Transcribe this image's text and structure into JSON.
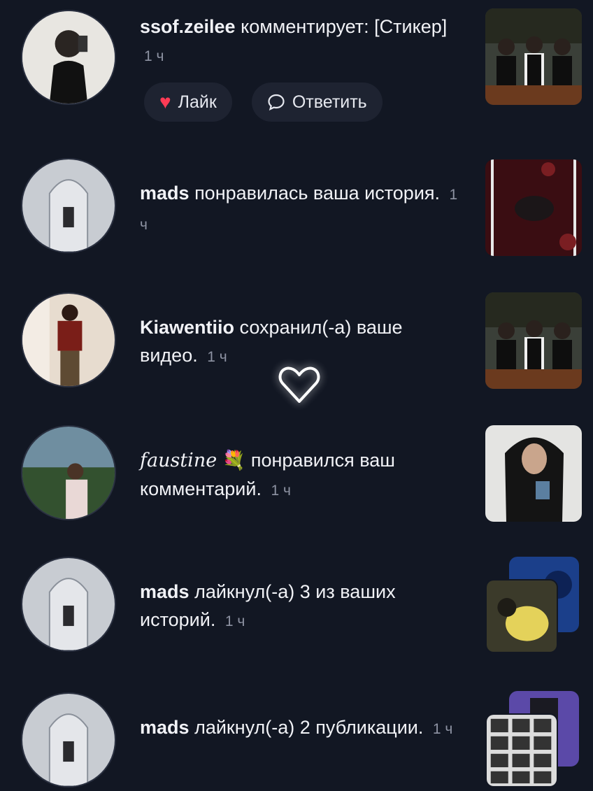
{
  "notifications": [
    {
      "user": "ssof.zeilee",
      "action": "комментирует: [Стикер]",
      "time": "1 ч"
    },
    {
      "user": "mads",
      "action": "понравилась ваша история.",
      "time": "1 ч"
    },
    {
      "user": "Kiawentiio",
      "action": "сохранил(-а) ваше видео.",
      "time": "1 ч"
    },
    {
      "user": "faustine",
      "emoji": "💐",
      "action": "понравился ваш комментарий.",
      "time": "1 ч"
    },
    {
      "user": "mads",
      "action": "лайкнул(-а) 3 из ваших историй.",
      "time": "1 ч"
    },
    {
      "user": "mads",
      "action": "лайкнул(-а) 2 публикации.",
      "time": "1 ч"
    }
  ],
  "actions": {
    "like_label": "Лайк",
    "reply_label": "Ответить"
  },
  "colors": {
    "background": "#121723",
    "like_heart": "#ff3b55",
    "pill_bg": "#1e2331"
  }
}
